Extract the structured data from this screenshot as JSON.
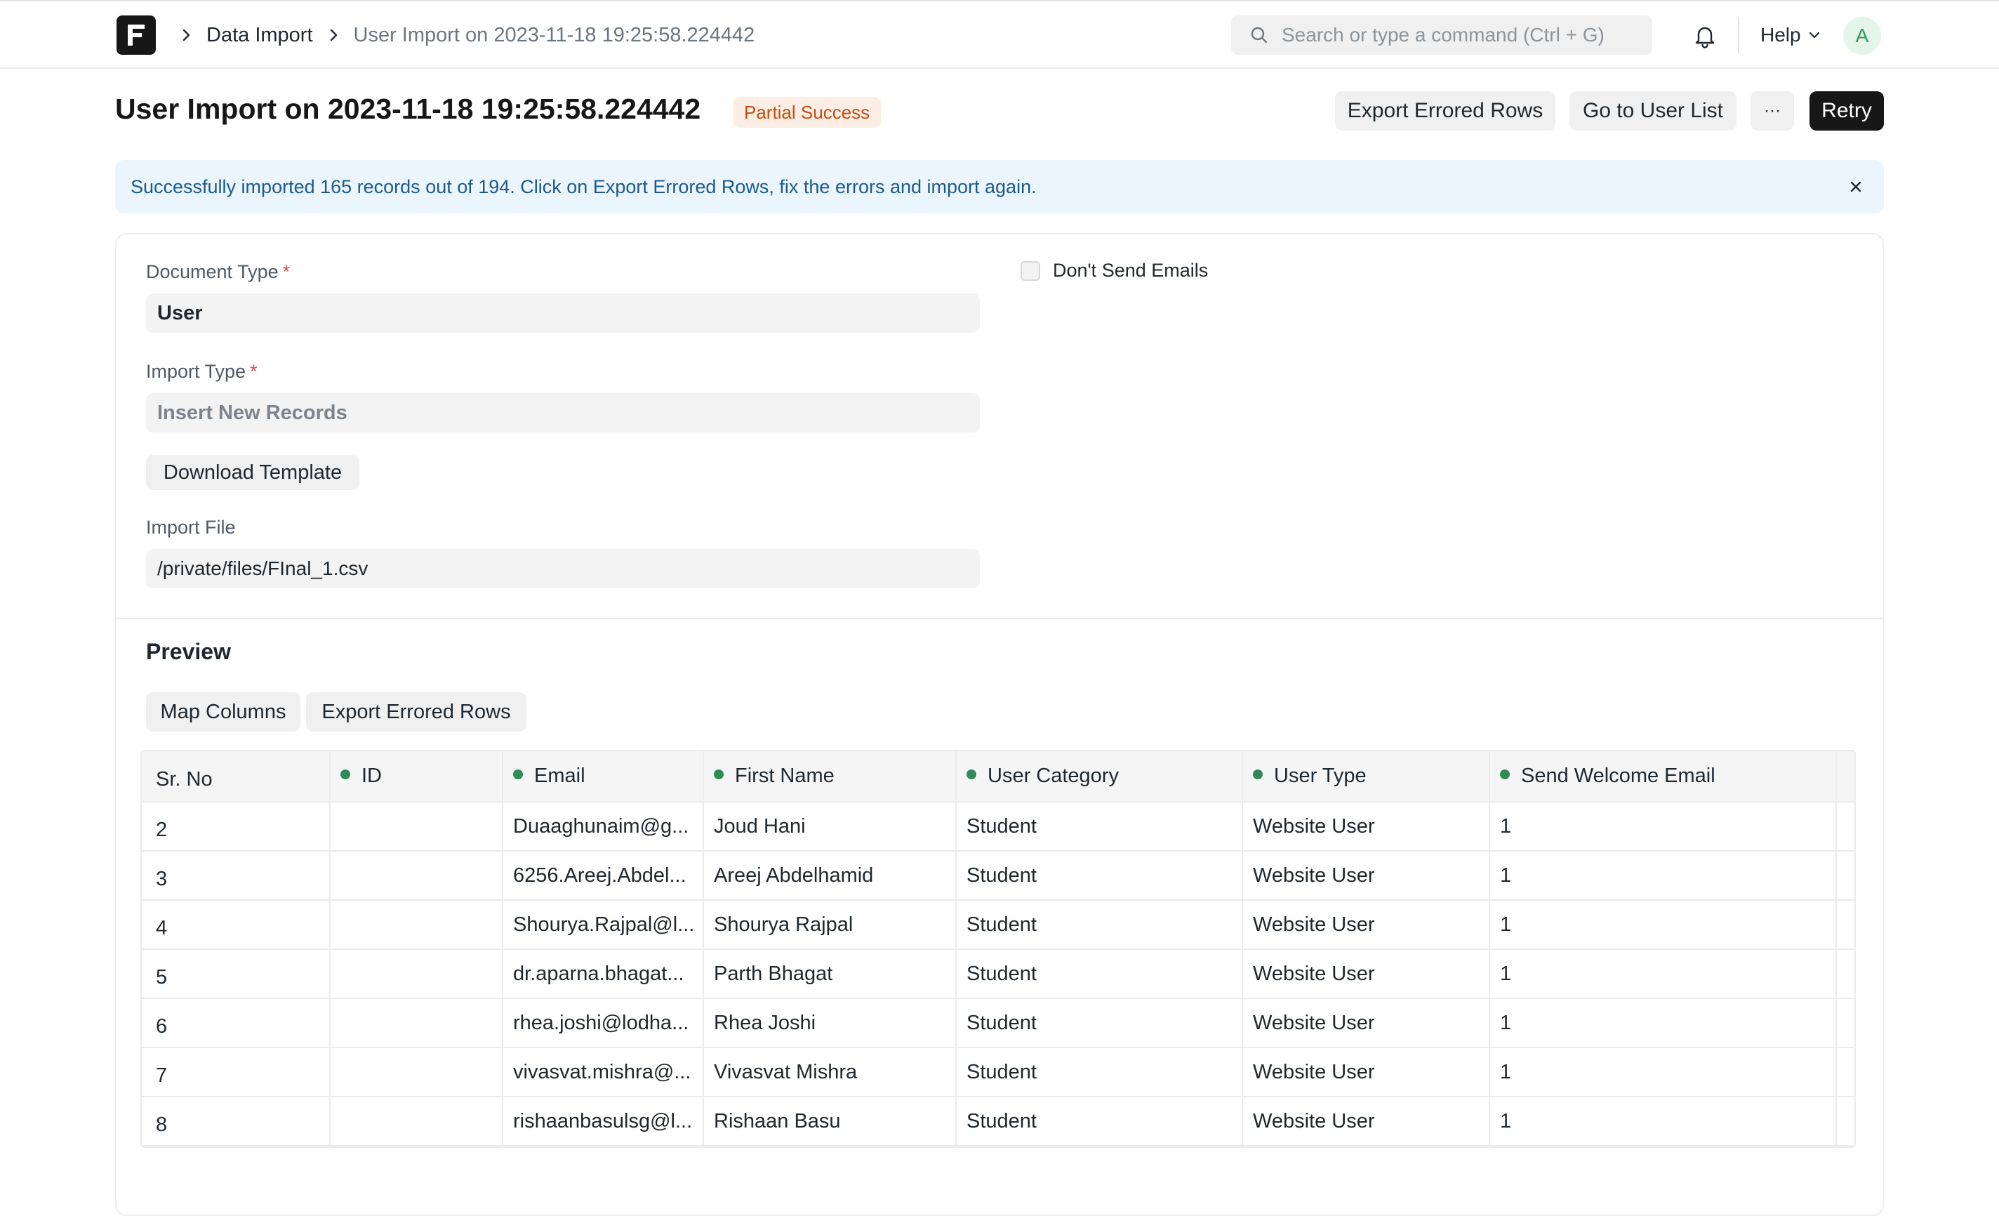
{
  "navbar": {
    "breadcrumbs": [
      "Data Import",
      "User Import on 2023-11-18 19:25:58.224442"
    ],
    "search_placeholder": "Search or type a command (Ctrl + G)",
    "help_label": "Help",
    "avatar_initial": "A"
  },
  "header": {
    "title": "User Import on 2023-11-18 19:25:58.224442",
    "status": "Partial Success",
    "actions": {
      "export_errored": "Export Errored Rows",
      "go_to_list": "Go to User List",
      "more": "···",
      "retry": "Retry"
    }
  },
  "alert": {
    "message": "Successfully imported 165 records out of 194. Click on Export Errored Rows, fix the errors and import again."
  },
  "form": {
    "document_type": {
      "label": "Document Type",
      "required": "*",
      "value": "User"
    },
    "import_type": {
      "label": "Import Type",
      "required": "*",
      "placeholder": "Insert New Records"
    },
    "download_template": "Download Template",
    "import_file": {
      "label": "Import File",
      "value": "/private/files/FInal_1.csv"
    },
    "dont_send_emails": {
      "label": "Don't Send Emails",
      "checked": false
    }
  },
  "preview": {
    "title": "Preview",
    "buttons": {
      "map_columns": "Map Columns",
      "export_errored": "Export Errored Rows"
    },
    "columns": [
      "Sr. No",
      "ID",
      "Email",
      "First Name",
      "User Category",
      "User Type",
      "Send Welcome Email"
    ],
    "rows": [
      [
        "2",
        "",
        "Duaaghunaim@g...",
        "Joud Hani",
        "Student",
        "Website User",
        "1"
      ],
      [
        "3",
        "",
        "6256.Areej.Abdel...",
        "Areej Abdelhamid",
        "Student",
        "Website User",
        "1"
      ],
      [
        "4",
        "",
        "Shourya.Rajpal@l...",
        "Shourya Rajpal",
        "Student",
        "Website User",
        "1"
      ],
      [
        "5",
        "",
        "dr.aparna.bhagat...",
        "Parth Bhagat",
        "Student",
        "Website User",
        "1"
      ],
      [
        "6",
        "",
        "rhea.joshi@lodha...",
        "Rhea Joshi",
        "Student",
        "Website User",
        "1"
      ],
      [
        "7",
        "",
        "vivasvat.mishra@...",
        "Vivasvat Mishra",
        "Student",
        "Website User",
        "1"
      ],
      [
        "8",
        "",
        "rishaanbasulsg@l...",
        "Rishaan Basu",
        "Student",
        "Website User",
        "1"
      ]
    ]
  },
  "colors": {
    "accent": "#171717",
    "badge_bg": "#fdeee5",
    "badge_text": "#c24d12",
    "alert_bg": "#eaf5fd",
    "alert_text": "#1d5a8a",
    "column_dot": "#2e8b57"
  },
  "icons": [
    "app-logo-icon",
    "chevron-right-icon",
    "search-icon",
    "bell-icon",
    "chevron-down-icon",
    "close-icon"
  ]
}
